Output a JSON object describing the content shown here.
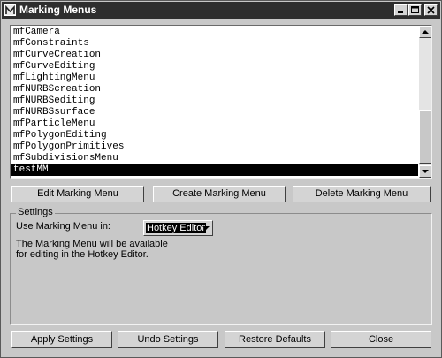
{
  "window": {
    "title": "Marking Menus",
    "icon": "maya-m-icon",
    "controls": [
      "minimize-icon",
      "maximize-icon",
      "close-icon"
    ]
  },
  "menu_list": {
    "items": [
      "mfCamera",
      "mfConstraints",
      "mfCurveCreation",
      "mfCurveEditing",
      "mfLightingMenu",
      "mfNURBScreation",
      "mfNURBSediting",
      "mfNURBSsurface",
      "mfParticleMenu",
      "mfPolygonEditing",
      "mfPolygonPrimitives",
      "mfSubdivisionsMenu",
      "testMM"
    ],
    "selected": "testMM"
  },
  "actions": {
    "edit": "Edit Marking Menu",
    "create": "Create Marking Menu",
    "delete": "Delete Marking Menu"
  },
  "settings": {
    "legend": "Settings",
    "use_label": "Use Marking Menu in:",
    "use_value": "Hotkey Editor",
    "note_line1": "The Marking Menu will be available",
    "note_line2": "for editing in the Hotkey Editor."
  },
  "footer": {
    "apply": "Apply Settings",
    "undo": "Undo Settings",
    "restore": "Restore Defaults",
    "close": "Close"
  }
}
